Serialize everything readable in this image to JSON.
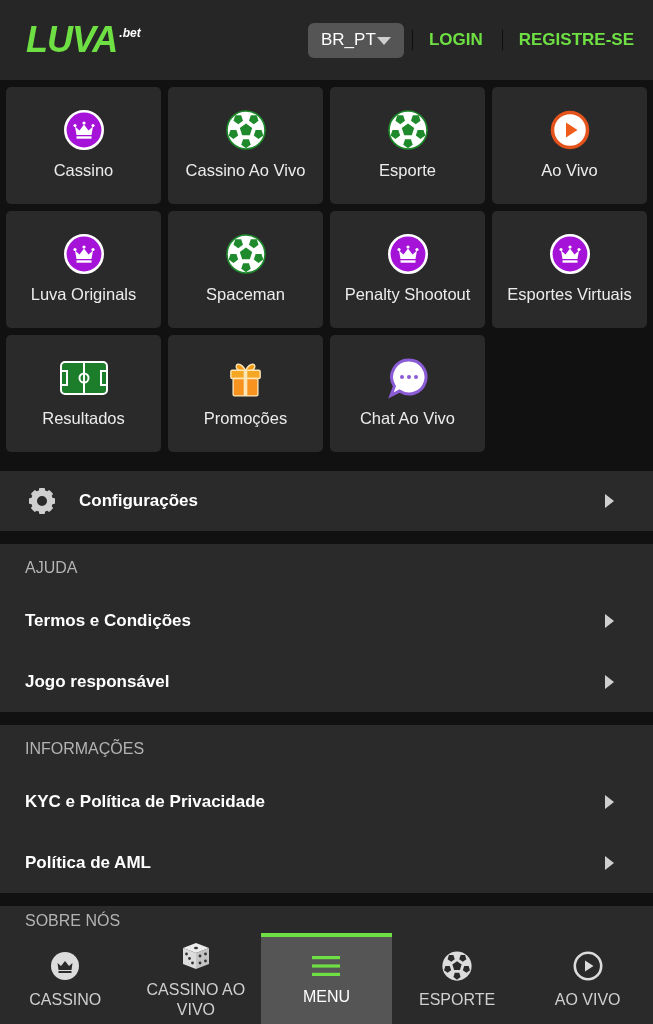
{
  "header": {
    "logo": {
      "wordmark": "LUVA",
      "suffix": ".bet"
    },
    "language": "BR_PT",
    "login": "LOGIN",
    "register": "REGISTRE-SE"
  },
  "tiles": [
    {
      "label": "Cassino",
      "kind": "crown"
    },
    {
      "label": "Cassino Ao Vivo",
      "kind": "ball"
    },
    {
      "label": "Esporte",
      "kind": "ball"
    },
    {
      "label": "Ao Vivo",
      "kind": "play"
    },
    {
      "label": "Luva Originals",
      "kind": "crown"
    },
    {
      "label": "Spaceman",
      "kind": "ball"
    },
    {
      "label": "Penalty Shootout",
      "kind": "crown"
    },
    {
      "label": "Esportes Virtuais",
      "kind": "crown"
    },
    {
      "label": "Resultados",
      "kind": "field"
    },
    {
      "label": "Promoções",
      "kind": "gift"
    },
    {
      "label": "Chat Ao Vivo",
      "kind": "chat"
    }
  ],
  "settings": {
    "label": "Configurações"
  },
  "sections": [
    {
      "title": "AJUDA",
      "items": [
        {
          "label": "Termos e Condições"
        },
        {
          "label": "Jogo responsável"
        }
      ]
    },
    {
      "title": "INFORMAÇÕES",
      "items": [
        {
          "label": "KYC e Política de Privacidade"
        },
        {
          "label": "Política de AML"
        }
      ]
    },
    {
      "title": "SOBRE NÓS"
    }
  ],
  "bottom_nav": [
    {
      "label": "CASSINO",
      "kind": "crown",
      "selected": false
    },
    {
      "label": "CASSINO AO VIVO",
      "kind": "dice",
      "selected": false
    },
    {
      "label": "MENU",
      "kind": "menu",
      "selected": true
    },
    {
      "label": "ESPORTE",
      "kind": "ball",
      "selected": false
    },
    {
      "label": "AO VIVO",
      "kind": "play",
      "selected": false
    }
  ]
}
